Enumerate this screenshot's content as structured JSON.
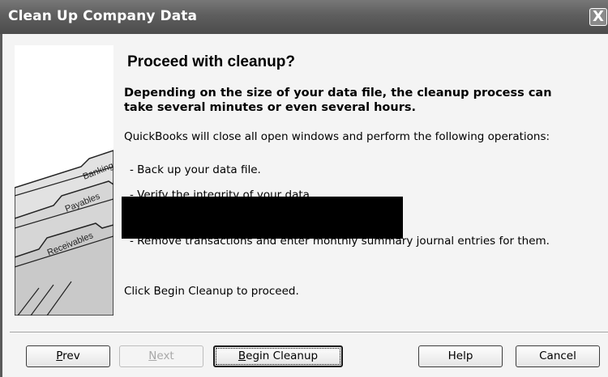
{
  "window": {
    "title": "Clean Up Company Data",
    "close_glyph": "X"
  },
  "illustration": {
    "tabs": [
      "Banking",
      "Payables",
      "Receivables"
    ]
  },
  "main": {
    "heading": "Proceed with cleanup?",
    "lead": "Depending on the size of your data file, the cleanup process can take several minutes or even several hours.",
    "intro": "QuickBooks will close all open windows and perform the following operations:",
    "operations": [
      "- Back up your data file.",
      "- Verify the integrity of your data.",
      "",
      "- Remove transactions and enter monthly summary journal entries for them."
    ],
    "footer": "Click Begin Cleanup to proceed."
  },
  "buttons": {
    "prev": {
      "mnemonic": "P",
      "rest": "rev"
    },
    "next": {
      "mnemonic": "N",
      "rest": "ext"
    },
    "begin": {
      "mnemonic": "B",
      "rest": "egin Cleanup"
    },
    "help": "Help",
    "cancel": "Cancel"
  }
}
